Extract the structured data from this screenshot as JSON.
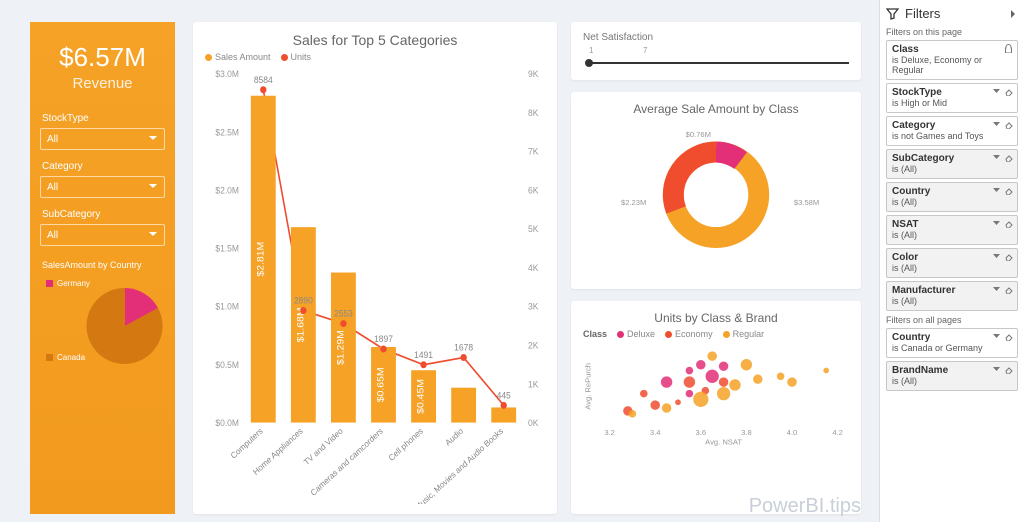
{
  "sidebar": {
    "revenue_value": "$6.57M",
    "revenue_label": "Revenue",
    "filters": [
      {
        "label": "StockType",
        "value": "All"
      },
      {
        "label": "Category",
        "value": "All"
      },
      {
        "label": "SubCategory",
        "value": "All"
      }
    ],
    "pie_title": "SalesAmount by Country",
    "pie_legend": [
      "Germany",
      "Canada"
    ]
  },
  "bar": {
    "title": "Sales for Top 5 Categories",
    "legend": [
      "Sales Amount",
      "Units"
    ]
  },
  "nsat": {
    "title": "Net Satisfaction",
    "min": "1",
    "max": "7"
  },
  "donut": {
    "title": "Average Sale Amount by Class",
    "labels": [
      "$0.76M",
      "$2.23M",
      "$3.58M"
    ]
  },
  "scatter": {
    "title": "Units by Class & Brand",
    "legend_title": "Class",
    "legend": [
      "Deluxe",
      "Economy",
      "Regular"
    ],
    "xlabel": "Avg. NSAT",
    "ylabel": "Avg. RePurch"
  },
  "filters_pane": {
    "title": "Filters",
    "section_page": "Filters on this page",
    "section_all": "Filters on all pages",
    "page": [
      {
        "name": "Class",
        "value": "is Deluxe, Economy or Regular",
        "lock": true
      },
      {
        "name": "StockType",
        "value": "is High or Mid"
      },
      {
        "name": "Category",
        "value": "is not Games and Toys"
      },
      {
        "name": "SubCategory",
        "value": "is (All)",
        "shaded": true
      },
      {
        "name": "Country",
        "value": "is (All)",
        "shaded": true
      },
      {
        "name": "NSAT",
        "value": "is (All)",
        "shaded": true
      },
      {
        "name": "Color",
        "value": "is (All)",
        "shaded": true
      },
      {
        "name": "Manufacturer",
        "value": "is (All)",
        "shaded": true
      }
    ],
    "all": [
      {
        "name": "Country",
        "value": "is Canada or Germany"
      },
      {
        "name": "BrandName",
        "value": "is (All)",
        "shaded": true
      }
    ]
  },
  "watermark": {
    "a": "PowerBI.",
    "b": "tips"
  },
  "chart_data": [
    {
      "type": "bar",
      "title": "Sales for Top 5 Categories",
      "categories": [
        "Computers",
        "Home Appliances",
        "TV and Video",
        "Cameras and camcorders",
        "Cell phones",
        "Audio",
        "Music, Movies and Audio Books"
      ],
      "series": [
        {
          "name": "Sales Amount",
          "unit": "$M",
          "values": [
            2.81,
            1.68,
            1.29,
            0.65,
            0.45,
            0.3,
            0.13
          ],
          "bar_labels": [
            "$2.81M",
            "$1.68M",
            "$1.29M",
            "$0.65M",
            "$0.45M",
            "",
            ""
          ]
        },
        {
          "name": "Units",
          "unit": "count",
          "values": [
            8584,
            2890,
            2553,
            1897,
            1491,
            1678,
            445
          ]
        }
      ],
      "y_left": {
        "label": "",
        "lim": [
          0,
          3.0
        ],
        "ticks": [
          "$0.0M",
          "$0.5M",
          "$1.0M",
          "$1.5M",
          "$2.0M",
          "$2.5M",
          "$3.0M"
        ]
      },
      "y_right": {
        "label": "",
        "lim": [
          0,
          9000
        ],
        "ticks": [
          "0K",
          "1K",
          "2K",
          "3K",
          "4K",
          "5K",
          "6K",
          "7K",
          "8K",
          "9K"
        ]
      }
    },
    {
      "type": "pie",
      "title": "SalesAmount by Country",
      "slices": [
        {
          "label": "Germany",
          "value": 0.3,
          "color": "#e22f77"
        },
        {
          "label": "Canada",
          "value": 0.7,
          "color": "#d47812"
        }
      ]
    },
    {
      "type": "pie",
      "title": "Average Sale Amount by Class",
      "donut": true,
      "slices": [
        {
          "label": "$0.76M",
          "value": 0.76,
          "color": "#e22f77"
        },
        {
          "label": "$2.23M",
          "value": 2.23,
          "color": "#f04d2f"
        },
        {
          "label": "$3.58M",
          "value": 3.58,
          "color": "#f5a227"
        }
      ]
    },
    {
      "type": "scatter",
      "title": "Units by Class & Brand",
      "xlabel": "Avg. NSAT",
      "ylabel": "Avg. RePurch",
      "xlim": [
        3.2,
        4.2
      ],
      "xticks": [
        3.2,
        3.4,
        3.6,
        3.8,
        4.0,
        4.2
      ],
      "series": [
        {
          "name": "Deluxe",
          "color": "#e22f77",
          "points": [
            [
              3.45,
              3.0,
              6
            ],
            [
              3.55,
              3.4,
              4
            ],
            [
              3.6,
              3.6,
              5
            ],
            [
              3.65,
              3.2,
              7
            ],
            [
              3.7,
              3.55,
              5
            ],
            [
              3.55,
              2.6,
              4
            ]
          ]
        },
        {
          "name": "Economy",
          "color": "#f04d2f",
          "points": [
            [
              3.28,
              2.0,
              5
            ],
            [
              3.35,
              2.6,
              4
            ],
            [
              3.4,
              2.2,
              5
            ],
            [
              3.5,
              2.3,
              3
            ],
            [
              3.55,
              3.0,
              6
            ],
            [
              3.62,
              2.7,
              4
            ],
            [
              3.7,
              3.0,
              5
            ]
          ]
        },
        {
          "name": "Regular",
          "color": "#f5a227",
          "points": [
            [
              3.3,
              1.9,
              4
            ],
            [
              3.45,
              2.1,
              5
            ],
            [
              3.6,
              2.4,
              8
            ],
            [
              3.7,
              2.6,
              7
            ],
            [
              3.75,
              2.9,
              6
            ],
            [
              3.85,
              3.1,
              5
            ],
            [
              3.95,
              3.2,
              4
            ],
            [
              3.8,
              3.6,
              6
            ],
            [
              3.65,
              3.9,
              5
            ],
            [
              4.0,
              3.0,
              5
            ],
            [
              4.15,
              3.4,
              3
            ]
          ]
        }
      ]
    }
  ]
}
